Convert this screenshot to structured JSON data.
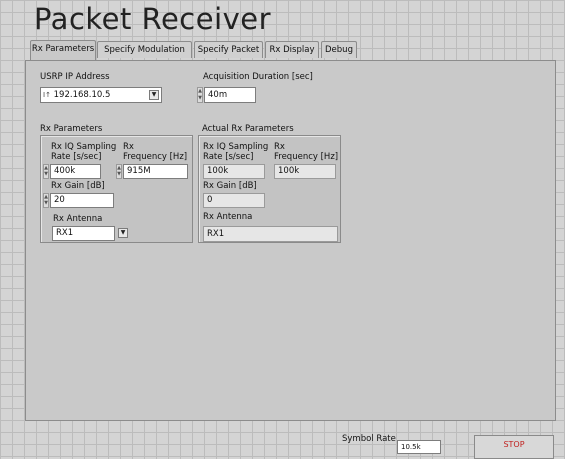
{
  "app": {
    "title": "Packet Receiver"
  },
  "tabs": [
    {
      "label": "Rx Parameters",
      "active": true
    },
    {
      "label": "Specify Modulation",
      "active": false
    },
    {
      "label": "Specify Packet",
      "active": false
    },
    {
      "label": "Rx Display",
      "active": false
    },
    {
      "label": "Debug",
      "active": false
    }
  ],
  "usrp": {
    "label": "USRP IP Address",
    "prefix": "I↑",
    "value": "192.168.10.5"
  },
  "acquisition": {
    "label": "Acquisition Duration [sec]",
    "value": "40m"
  },
  "rx_params": {
    "header": "Rx Parameters",
    "iq_rate_label": "Rx IQ Sampling\nRate [s/sec]",
    "iq_rate_value": "400k",
    "freq_label": "Rx\nFrequency [Hz]",
    "freq_value": "915M",
    "gain_label": "Rx Gain [dB]",
    "gain_value": "20",
    "antenna_label": "Rx Antenna",
    "antenna_value": "RX1"
  },
  "actual_rx_params": {
    "header": "Actual Rx Parameters",
    "iq_rate_label": "Rx IQ Sampling\nRate [s/sec]",
    "iq_rate_value": "100k",
    "freq_label": "Rx\nFrequency [Hz]",
    "freq_value": "100k",
    "gain_label": "Rx Gain [dB]",
    "gain_value": "0",
    "antenna_label": "Rx Antenna",
    "antenna_value": "RX1"
  },
  "footer": {
    "symbol_rate_label": "Symbol Rate",
    "symbol_rate_value": "10.5k",
    "stop_label": "STOP"
  },
  "colors": {
    "background": "#d4d4d4",
    "panel": "#c9c9c9",
    "stop_text": "#c0211f"
  }
}
